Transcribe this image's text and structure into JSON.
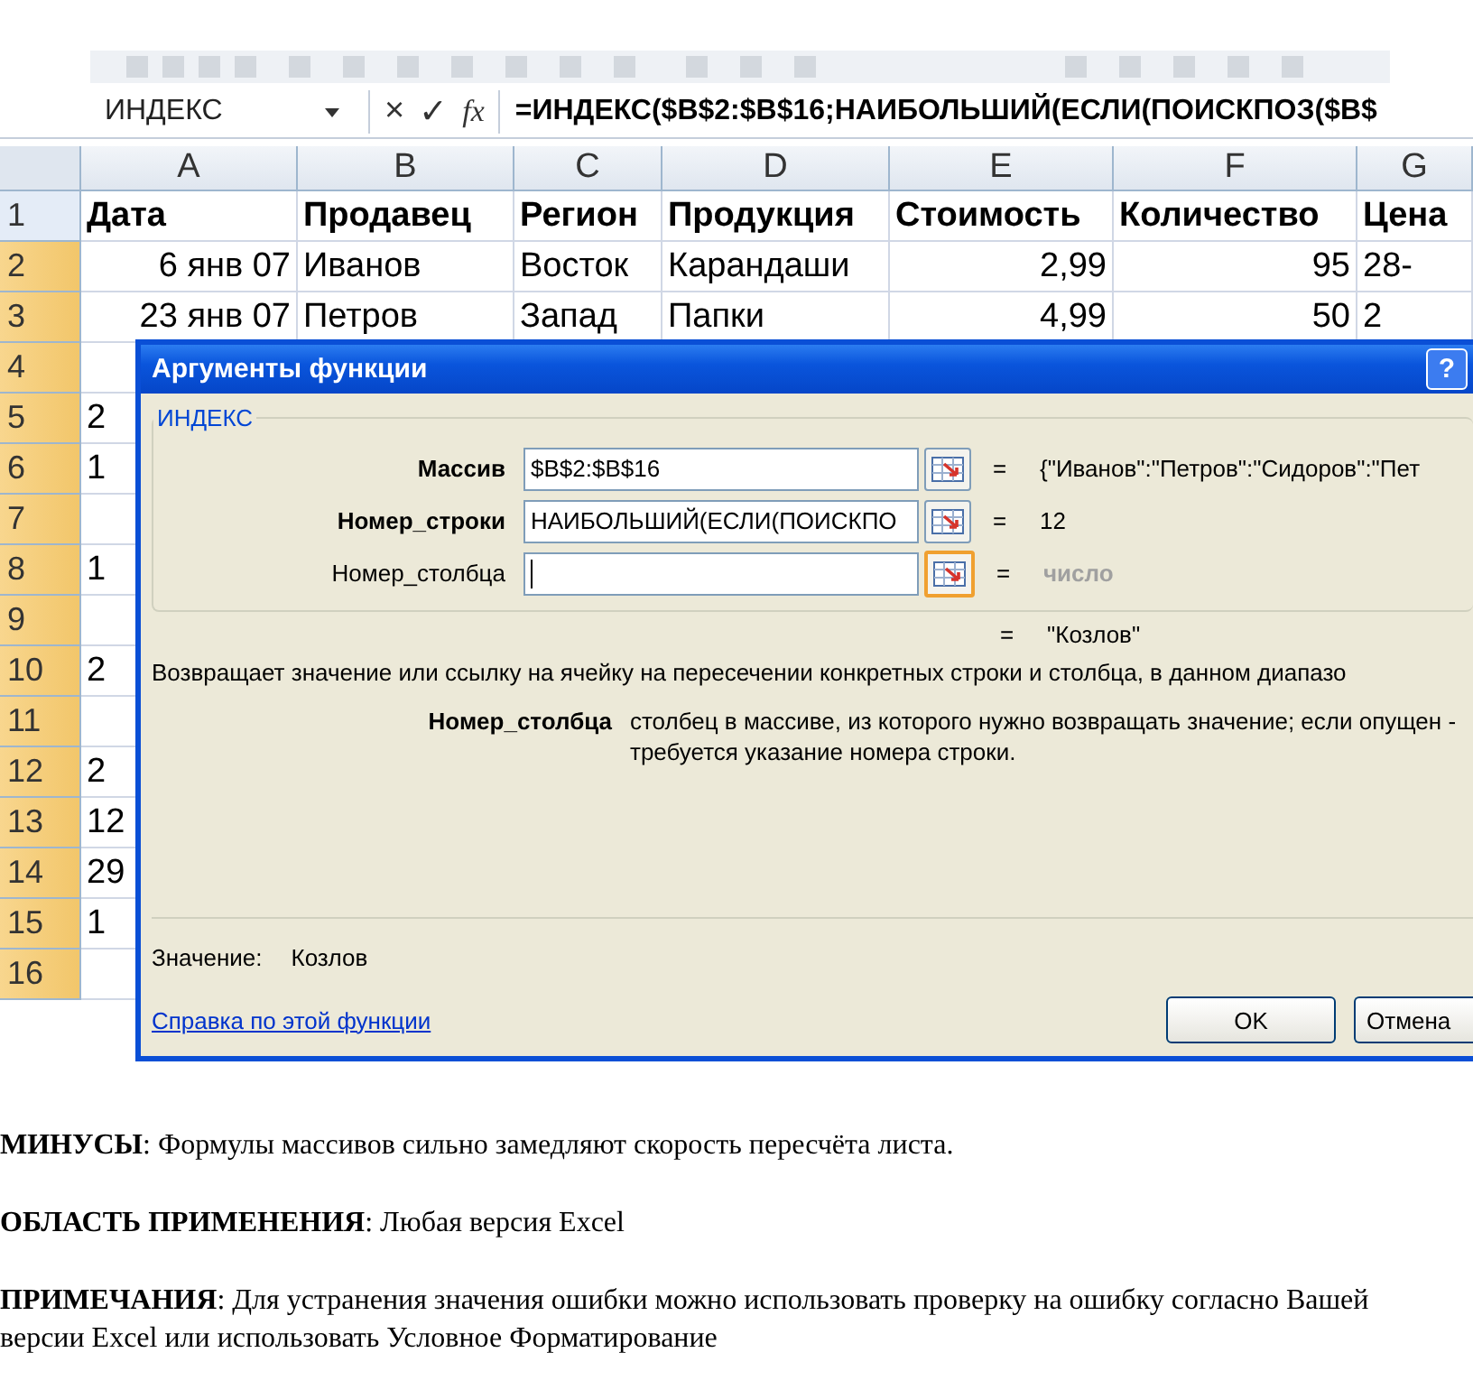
{
  "formula_bar": {
    "name_box": "ИНДЕКС",
    "cancel": "×",
    "enter": "✓",
    "insert_function": "fx",
    "formula": "=ИНДЕКС($B$2:$B$16;НАИБОЛЬШИЙ(ЕСЛИ(ПОИСКПОЗ($B$"
  },
  "sheet": {
    "columns": [
      "A",
      "B",
      "C",
      "D",
      "E",
      "F",
      "G"
    ],
    "rows": [
      {
        "number": "1",
        "selected": false,
        "kind": "header",
        "cells": [
          "Дата",
          "Продавец",
          "Регион",
          "Продукция",
          "Стоимость",
          "Количество",
          "Цена"
        ]
      },
      {
        "number": "2",
        "selected": true,
        "kind": "data",
        "cells": [
          "6 янв 07",
          "Иванов",
          "Восток",
          "Карандаши",
          "2,99",
          "95",
          "28-"
        ]
      },
      {
        "number": "3",
        "selected": true,
        "kind": "data",
        "cells": [
          "23 янв 07",
          "Петров",
          "Запад",
          "Папки",
          "4,99",
          "50",
          "2"
        ]
      },
      {
        "number": "4",
        "selected": true,
        "kind": "covered",
        "cells": []
      },
      {
        "number": "5",
        "selected": true,
        "kind": "covered",
        "cells": [
          "2"
        ]
      },
      {
        "number": "6",
        "selected": true,
        "kind": "covered",
        "cells": [
          "1"
        ]
      },
      {
        "number": "7",
        "selected": true,
        "kind": "covered",
        "cells": []
      },
      {
        "number": "8",
        "selected": true,
        "kind": "covered",
        "cells": [
          "1"
        ]
      },
      {
        "number": "9",
        "selected": true,
        "kind": "covered",
        "cells": []
      },
      {
        "number": "10",
        "selected": true,
        "kind": "covered",
        "cells": [
          "2"
        ]
      },
      {
        "number": "11",
        "selected": true,
        "kind": "covered",
        "cells": []
      },
      {
        "number": "12",
        "selected": true,
        "kind": "covered",
        "cells": [
          "2"
        ]
      },
      {
        "number": "13",
        "selected": true,
        "kind": "covered",
        "cells": [
          "12"
        ]
      },
      {
        "number": "14",
        "selected": true,
        "kind": "covered",
        "cells": [
          "29"
        ]
      },
      {
        "number": "15",
        "selected": true,
        "kind": "covered",
        "cells": [
          "1"
        ]
      },
      {
        "number": "16",
        "selected": true,
        "kind": "covered",
        "cells": []
      }
    ]
  },
  "dialog": {
    "title": "Аргументы функции",
    "help": "?",
    "function_name": "ИНДЕКС",
    "arguments": [
      {
        "label": "Массив",
        "required": true,
        "value": "$B$2:$B$16",
        "equals": "=",
        "result": "{\"Иванов\":\"Петров\":\"Сидоров\":\"Пет",
        "result_muted": false,
        "focused": false
      },
      {
        "label": "Номер_строки",
        "required": true,
        "value": "НАИБОЛЬШИЙ(ЕСЛИ(ПОИСКПО",
        "equals": "=",
        "result": "12",
        "result_muted": false,
        "focused": false
      },
      {
        "label": "Номер_столбца",
        "required": false,
        "equals": "=",
        "result": "число",
        "result_muted": true,
        "focused": true
      }
    ],
    "result": {
      "equals": "=",
      "value": "\"Козлов\""
    },
    "description": "Возвращает значение или ссылку на ячейку на пересечении конкретных строки и столбца, в данном диапазо",
    "arg_help": {
      "name": "Номер_столбца",
      "text": "столбец в массиве, из которого нужно возвращать значение; если опущен - требуется указание номера строки."
    },
    "value_label": "Значение:",
    "value": "Козлов",
    "help_link": "Справка по этой функции",
    "buttons": [
      {
        "label": "OK"
      },
      {
        "label": "Отмена"
      }
    ]
  },
  "notes": [
    "**МИНУСЫ**: Формулы массивов сильно замедляют скорость пересчёта листа.",
    "**ОБЛАСТЬ ПРИМЕНЕНИЯ**: Любая версия Excel",
    "**ПРИМЕЧАНИЯ**: Для устранения значения ошибки можно использовать проверку на ошибку согласно Вашей версии Excel или использовать Условное Форматирование"
  ]
}
